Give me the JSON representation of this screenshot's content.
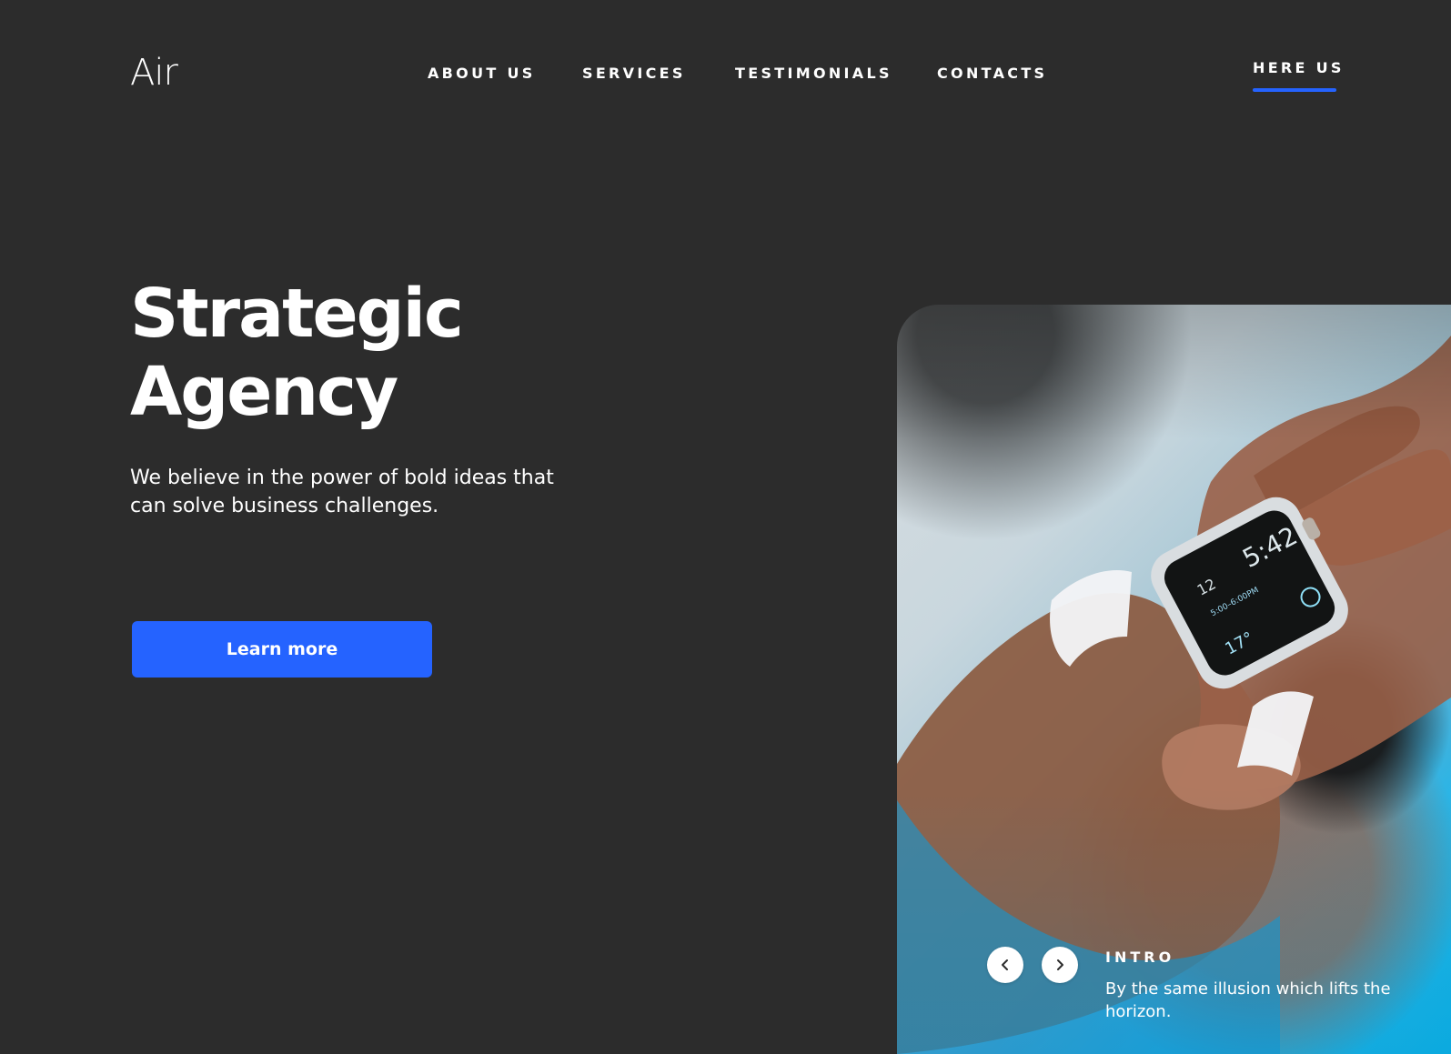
{
  "header": {
    "logo": "Air",
    "nav": [
      {
        "label": "ABOUT US"
      },
      {
        "label": "SERVICES"
      },
      {
        "label": "TESTIMONIALS"
      },
      {
        "label": "CONTACTS"
      }
    ],
    "cta": "HERE US"
  },
  "hero": {
    "title_line_1": "Strategic",
    "title_line_2": "Agency",
    "text": "We believe in the power of bold ideas that can solve business challenges.",
    "button": "Learn more"
  },
  "slider": {
    "label": "INTRO",
    "text": "By the same illusion which lifts the horizon.",
    "prev_icon": "chevron-left-icon",
    "next_icon": "chevron-right-icon"
  },
  "photo": {
    "watch_time": "5:42",
    "watch_date": "12",
    "watch_event": "5:00–6:00PM",
    "watch_temp": "17°"
  },
  "colors": {
    "background": "#2c2c2c",
    "accent": "#2563ff",
    "text": "#ffffff",
    "photo_blue": "#0db3e6"
  }
}
